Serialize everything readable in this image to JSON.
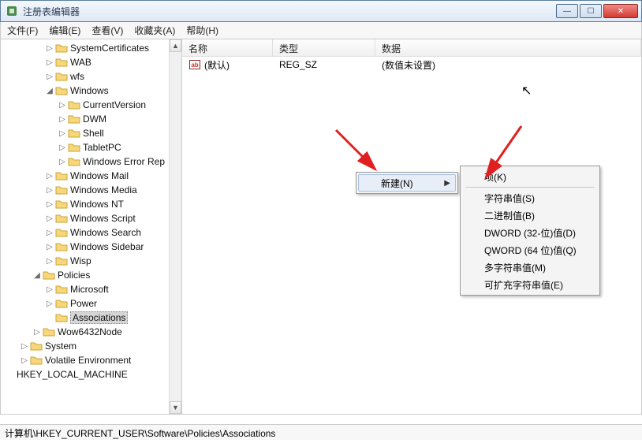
{
  "window": {
    "title": "注册表编辑器"
  },
  "menu": {
    "file": "文件(F)",
    "edit": "编辑(E)",
    "view": "查看(V)",
    "favorites": "收藏夹(A)",
    "help": "帮助(H)"
  },
  "tree": [
    {
      "indent": 2,
      "twist": "▷",
      "label": "SystemCertificates"
    },
    {
      "indent": 2,
      "twist": "▷",
      "label": "WAB"
    },
    {
      "indent": 2,
      "twist": "▷",
      "label": "wfs"
    },
    {
      "indent": 2,
      "twist": "◢",
      "label": "Windows"
    },
    {
      "indent": 3,
      "twist": "▷",
      "label": "CurrentVersion"
    },
    {
      "indent": 3,
      "twist": "▷",
      "label": "DWM"
    },
    {
      "indent": 3,
      "twist": "▷",
      "label": "Shell"
    },
    {
      "indent": 3,
      "twist": "▷",
      "label": "TabletPC"
    },
    {
      "indent": 3,
      "twist": "▷",
      "label": "Windows Error Rep"
    },
    {
      "indent": 2,
      "twist": "▷",
      "label": "Windows Mail"
    },
    {
      "indent": 2,
      "twist": "▷",
      "label": "Windows Media"
    },
    {
      "indent": 2,
      "twist": "▷",
      "label": "Windows NT"
    },
    {
      "indent": 2,
      "twist": "▷",
      "label": "Windows Script"
    },
    {
      "indent": 2,
      "twist": "▷",
      "label": "Windows Search"
    },
    {
      "indent": 2,
      "twist": "▷",
      "label": "Windows Sidebar"
    },
    {
      "indent": 2,
      "twist": "▷",
      "label": "Wisp"
    },
    {
      "indent": 1,
      "twist": "◢",
      "label": "Policies"
    },
    {
      "indent": 2,
      "twist": "▷",
      "label": "Microsoft"
    },
    {
      "indent": 2,
      "twist": "▷",
      "label": "Power"
    },
    {
      "indent": 2,
      "twist": "",
      "label": "Associations",
      "selected": true
    },
    {
      "indent": 1,
      "twist": "▷",
      "label": "Wow6432Node"
    },
    {
      "indent": 0,
      "twist": "▷",
      "label": "System"
    },
    {
      "indent": 0,
      "twist": "▷",
      "label": "Volatile Environment"
    },
    {
      "indent": -1,
      "twist": "",
      "label": "HKEY_LOCAL_MACHINE",
      "nofolder": true
    }
  ],
  "columns": {
    "name": "名称",
    "type": "类型",
    "data": "数据"
  },
  "rows": [
    {
      "name": "(默认)",
      "type": "REG_SZ",
      "data": "(数值未设置)"
    }
  ],
  "ctx1": {
    "new": "新建(N)"
  },
  "ctx2": {
    "key": "项(K)",
    "string": "字符串值(S)",
    "binary": "二进制值(B)",
    "dword": "DWORD (32-位)值(D)",
    "qword": "QWORD (64 位)值(Q)",
    "multi": "多字符串值(M)",
    "expand": "可扩充字符串值(E)"
  },
  "status": "计算机\\HKEY_CURRENT_USER\\Software\\Policies\\Associations"
}
